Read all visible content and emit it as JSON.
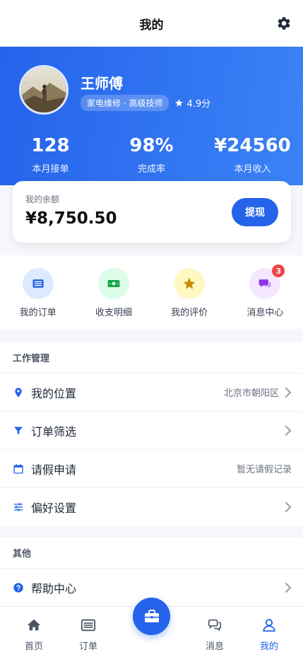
{
  "header": {
    "title": "我的",
    "settings_icon": "gear-icon"
  },
  "profile": {
    "name": "王师傅",
    "tag": "家电维修 · 高级技师",
    "rating": "4.9分",
    "stats": [
      {
        "value": "128",
        "label": "本月接单"
      },
      {
        "value": "98%",
        "label": "完成率"
      },
      {
        "value": "¥24560",
        "label": "本月收入"
      }
    ]
  },
  "balance": {
    "label": "我的余额",
    "amount": "¥8,750.50",
    "withdraw_label": "提现"
  },
  "quick_actions": [
    {
      "label": "我的订单",
      "icon": "order-list-icon"
    },
    {
      "label": "收支明细",
      "icon": "money-bill-icon"
    },
    {
      "label": "我的评价",
      "icon": "star-icon"
    },
    {
      "label": "消息中心",
      "icon": "chat-icon",
      "badge": "3"
    }
  ],
  "work_section": {
    "title": "工作管理",
    "rows": [
      {
        "label": "我的位置",
        "value": "北京市朝阳区",
        "icon": "location-pin-icon"
      },
      {
        "label": "订单筛选",
        "value": "",
        "icon": "filter-icon"
      },
      {
        "label": "请假申请",
        "value": "暂无请假记录",
        "icon": "calendar-icon"
      },
      {
        "label": "偏好设置",
        "value": "",
        "icon": "sliders-icon"
      }
    ]
  },
  "other_section": {
    "title": "其他",
    "rows": [
      {
        "label": "帮助中心",
        "value": "",
        "icon": "help-circle-icon"
      }
    ]
  },
  "tabbar": {
    "items": [
      {
        "label": "首页",
        "icon": "home-icon"
      },
      {
        "label": "订单",
        "icon": "order-list-icon"
      },
      {
        "label": "消息",
        "icon": "chat-icon"
      },
      {
        "label": "我的",
        "icon": "user-icon",
        "active": true
      }
    ],
    "center_icon": "briefcase-icon"
  },
  "colors": {
    "primary": "#2563eb",
    "badge": "#ef4444"
  }
}
